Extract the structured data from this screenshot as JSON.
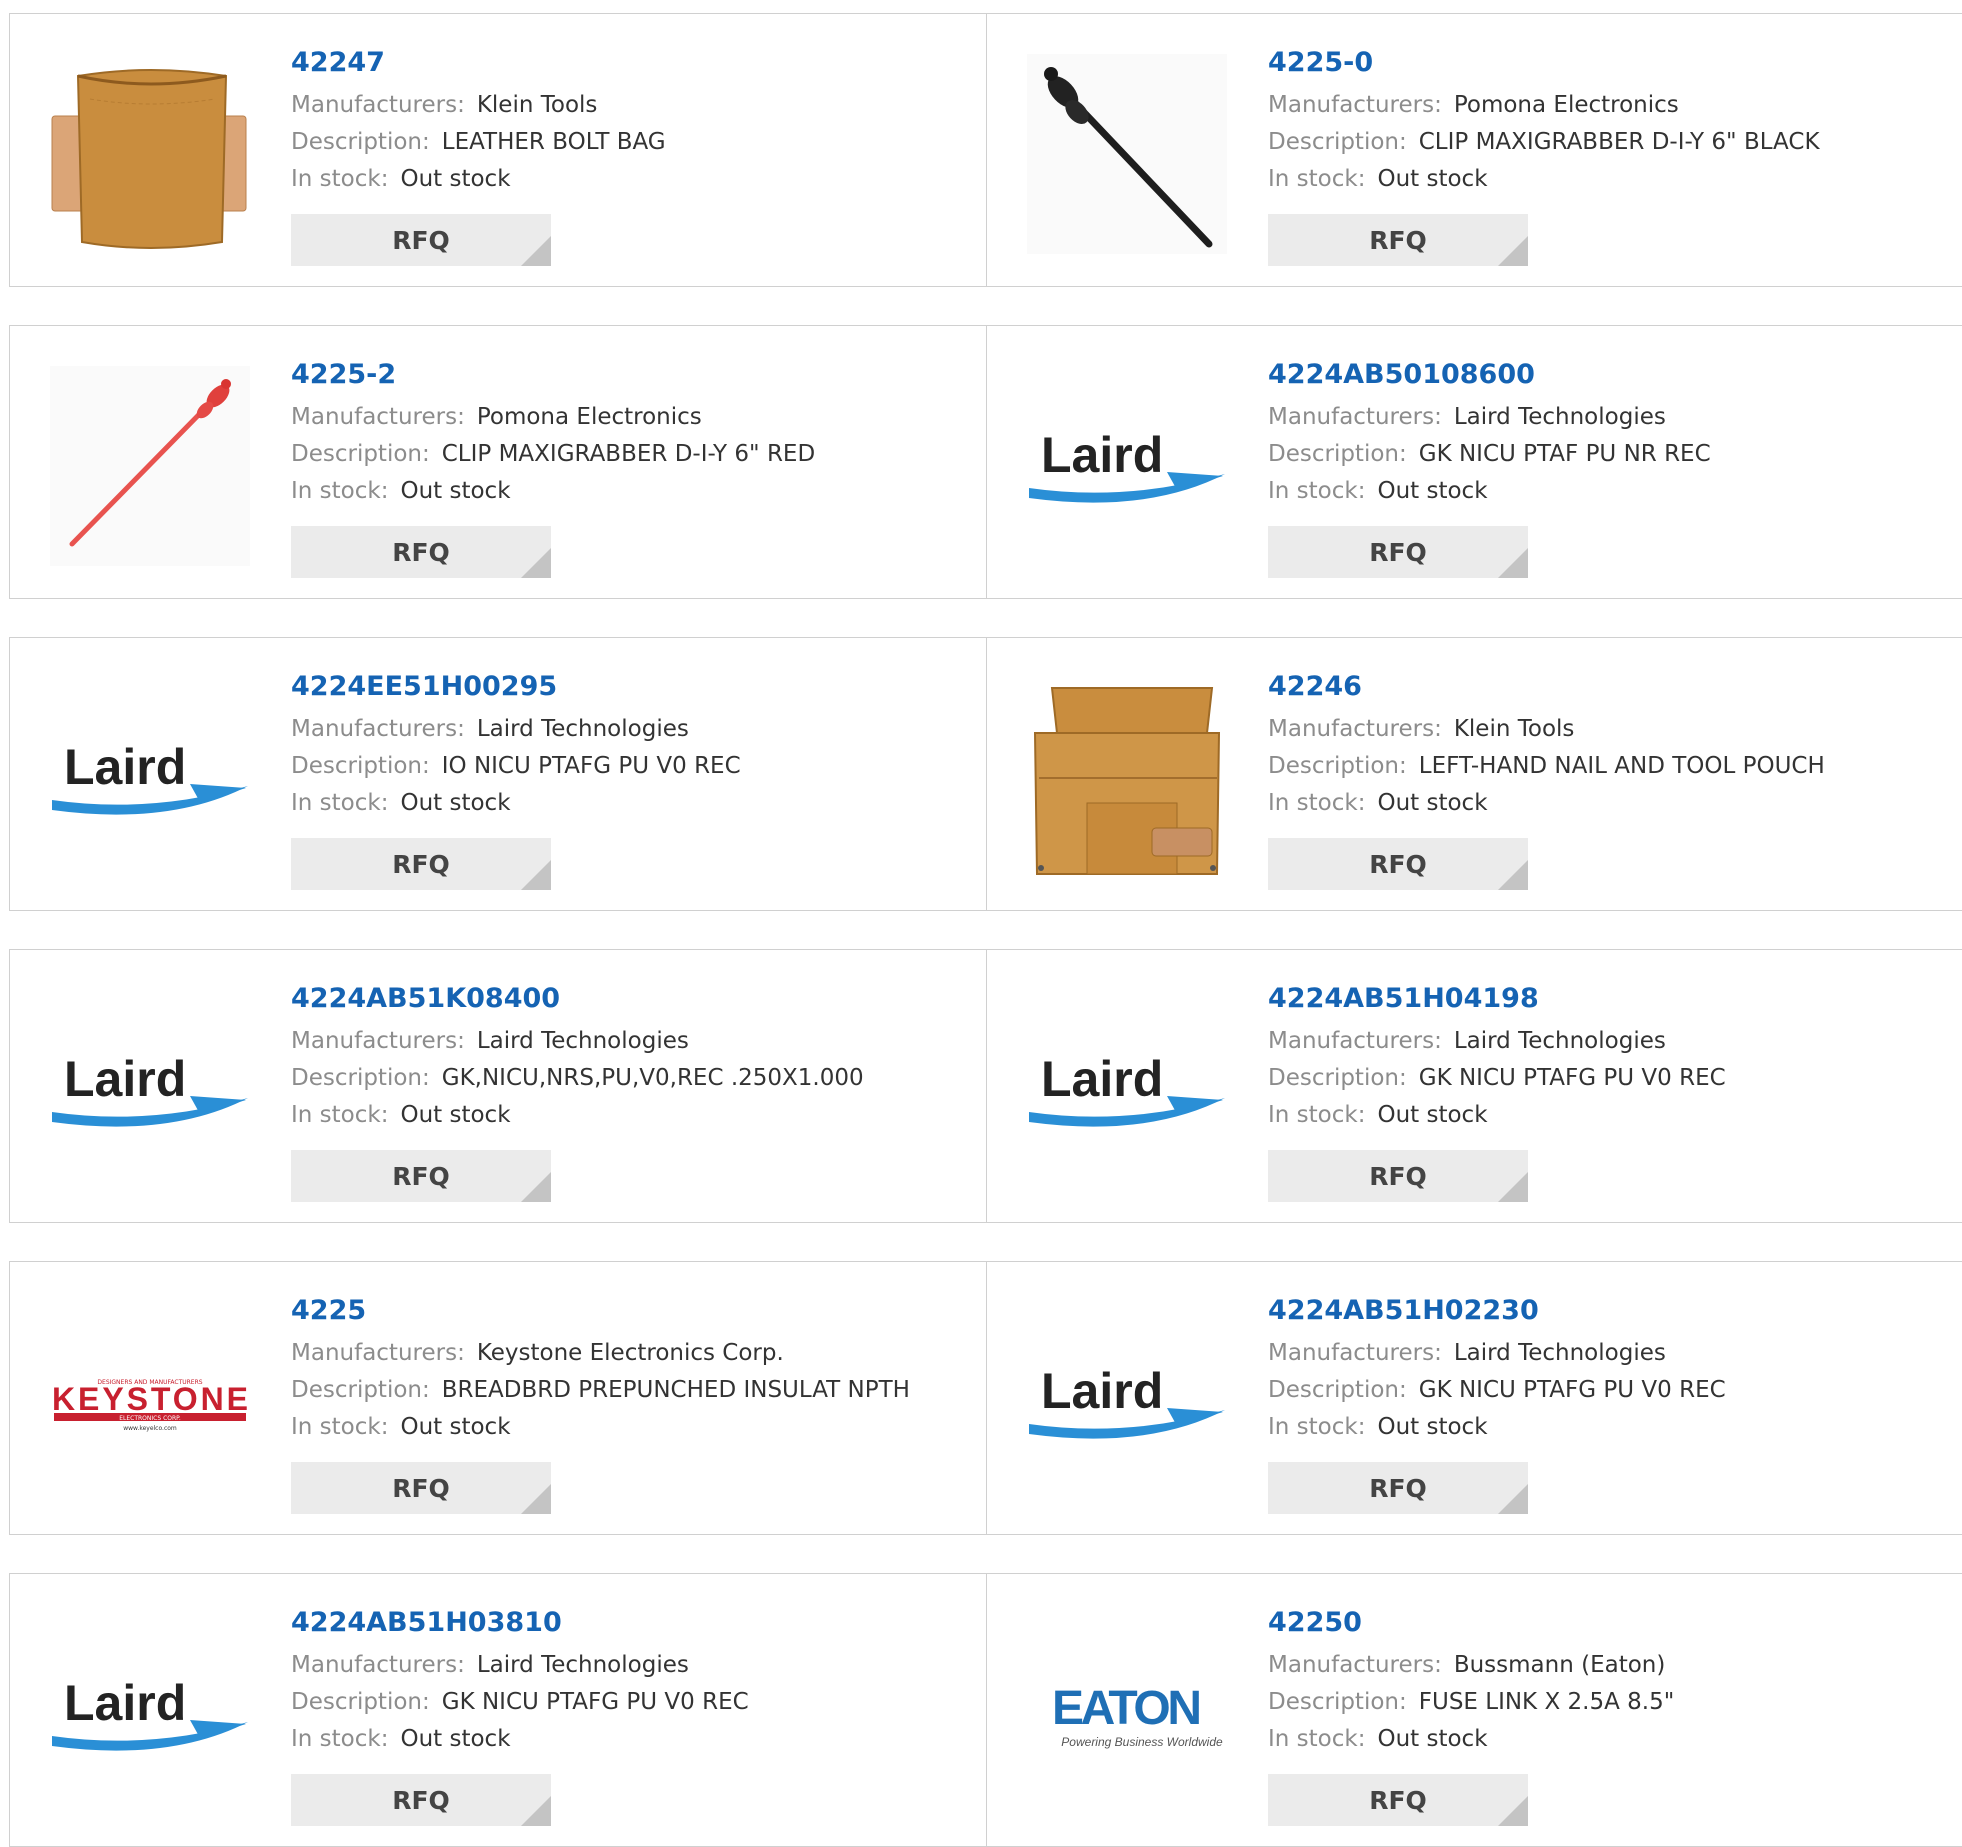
{
  "labels": {
    "manufacturer": "Manufacturers:",
    "description": "Description:",
    "stock": "In stock:",
    "rfq": "RFQ"
  },
  "products": [
    {
      "part": "42247",
      "manufacturer": "Klein Tools",
      "description": "LEATHER BOLT BAG",
      "stock": "Out stock",
      "image": "leather-bolt-bag"
    },
    {
      "part": "4225-0",
      "manufacturer": "Pomona Electronics",
      "description": "CLIP MAXIGRABBER D-I-Y 6\" BLACK",
      "stock": "Out stock",
      "image": "black-probe-clip"
    },
    {
      "part": "4225-2",
      "manufacturer": "Pomona Electronics",
      "description": "CLIP MAXIGRABBER D-I-Y 6\" RED",
      "stock": "Out stock",
      "image": "red-probe-clip"
    },
    {
      "part": "4224AB50108600",
      "manufacturer": "Laird Technologies",
      "description": "GK NICU PTAF PU NR REC",
      "stock": "Out stock",
      "image": "laird-logo"
    },
    {
      "part": "4224EE51H00295",
      "manufacturer": "Laird Technologies",
      "description": "IO NICU PTAFG PU V0 REC",
      "stock": "Out stock",
      "image": "laird-logo"
    },
    {
      "part": "42246",
      "manufacturer": "Klein Tools",
      "description": "LEFT-HAND NAIL AND TOOL POUCH",
      "stock": "Out stock",
      "image": "tool-pouch"
    },
    {
      "part": "4224AB51K08400",
      "manufacturer": "Laird Technologies",
      "description": "GK,NICU,NRS,PU,V0,REC .250X1.000",
      "stock": "Out stock",
      "image": "laird-logo"
    },
    {
      "part": "4224AB51H04198",
      "manufacturer": "Laird Technologies",
      "description": "GK NICU PTAFG PU V0 REC",
      "stock": "Out stock",
      "image": "laird-logo"
    },
    {
      "part": "4225",
      "manufacturer": "Keystone Electronics Corp.",
      "description": "BREADBRD PREPUNCHED INSULAT NPTH",
      "stock": "Out stock",
      "image": "keystone-logo"
    },
    {
      "part": "4224AB51H02230",
      "manufacturer": "Laird Technologies",
      "description": "GK NICU PTAFG PU V0 REC",
      "stock": "Out stock",
      "image": "laird-logo"
    },
    {
      "part": "4224AB51H03810",
      "manufacturer": "Laird Technologies",
      "description": "GK NICU PTAFG PU V0 REC",
      "stock": "Out stock",
      "image": "laird-logo"
    },
    {
      "part": "42250",
      "manufacturer": "Bussmann (Eaton)",
      "description": "FUSE LINK X 2.5A 8.5\"",
      "stock": "Out stock",
      "image": "eaton-logo"
    }
  ],
  "logos": {
    "laird": "Laird",
    "keystone": "KEYSTONE",
    "keystone_top": "DESIGNERS AND MANUFACTURERS",
    "keystone_mid": "ELECTRONICS CORP.",
    "keystone_url": "www.keyelco.com",
    "eaton": "EATON",
    "eaton_tagline": "Powering Business Worldwide"
  },
  "colors": {
    "part_link": "#1563b3",
    "label": "#8c8c8c",
    "rfq_bg": "#ebebeb",
    "border": "#d0d0d0",
    "laird_swoosh": "#2a8fd6",
    "keystone_red": "#c8202f",
    "eaton_blue": "#1f6fb5"
  }
}
